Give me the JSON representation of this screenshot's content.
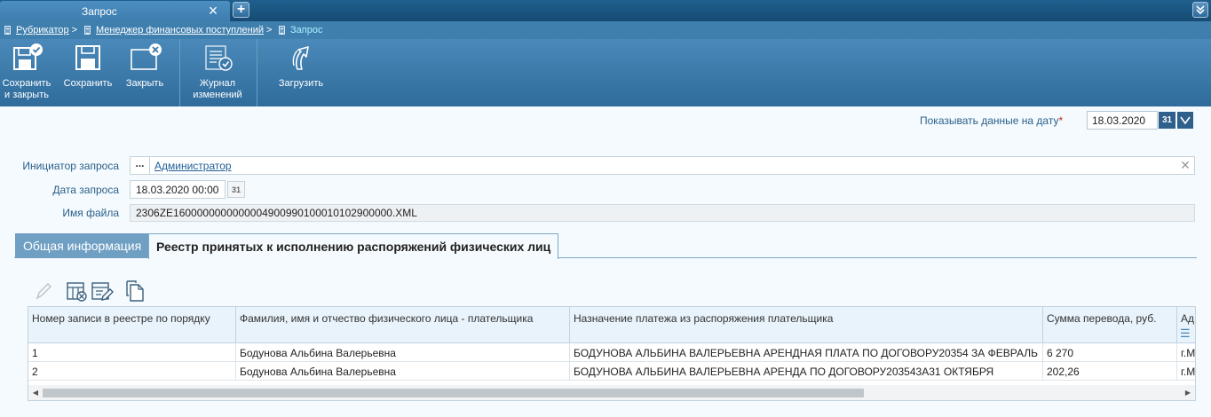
{
  "tab": {
    "title": "Запрос",
    "close_glyph": "×",
    "add_glyph": "+"
  },
  "breadcrumb": [
    {
      "label": "Рубрикатор",
      "sep": ">"
    },
    {
      "label": "Менеджер финансовых поступлений",
      "sep": ">"
    },
    {
      "label": "Запрос",
      "sep": ""
    }
  ],
  "toolbar": {
    "save_close": "Сохранить\nи закрыть",
    "save": "Сохранить",
    "close": "Закрыть",
    "journal": "Журнал\nизменений",
    "upload": "Загрузить"
  },
  "date_filter": {
    "label": "Показывать данные на дату",
    "required_mark": "*",
    "value": "18.03.2020",
    "cal_label": "31"
  },
  "form": {
    "initiator_label": "Инициатор запроса",
    "initiator_value": "Администратор",
    "ellipsis": "...",
    "request_date_label": "Дата запроса",
    "request_date_value": "18.03.2020 00:00",
    "request_date_cal": "31",
    "filename_label": "Имя файла",
    "filename_value": "2306ZE1600000000000004900990100010102900000.XML"
  },
  "sections": {
    "general": "Общая информация",
    "registry": "Реестр принятых к исполнению распоряжений физических лиц"
  },
  "grid": {
    "columns": [
      "Номер записи в реестре по порядку",
      "Фамилия, имя и отчество физического лица - плательщика",
      "Назначение платежа из распоряжения плательщика",
      "Сумма перевода, руб.",
      "Ад"
    ],
    "rows": [
      [
        "1",
        "Бодунова Альбина Валерьевна",
        "БОДУНОВА АЛЬБИНА ВАЛЕРЬЕВНА АРЕНДНАЯ ПЛАТА ПО ДОГОВОРУ20354 ЗА ФЕВРАЛЬ",
        "6 270",
        "г.М"
      ],
      [
        "2",
        "Бодунова Альбина Валерьевна",
        "БОДУНОВА АЛЬБИНА ВАЛЕРЬЕВНА АРЕНДА ПО ДОГОВОРУ203543А31 ОКТЯБРЯ",
        "202,26",
        "г.М"
      ]
    ]
  }
}
